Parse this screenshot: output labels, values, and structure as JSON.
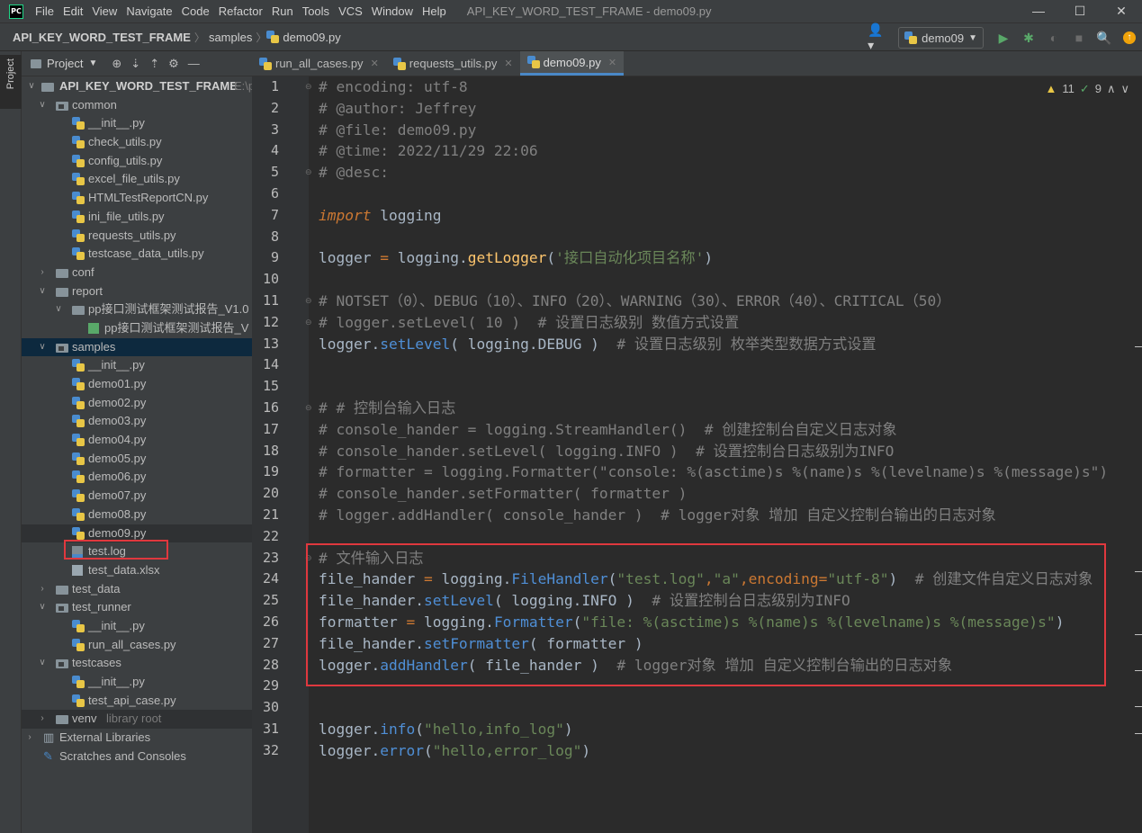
{
  "menubar": {
    "logo": "PC",
    "items": [
      "File",
      "Edit",
      "View",
      "Navigate",
      "Code",
      "Refactor",
      "Run",
      "Tools",
      "VCS",
      "Window",
      "Help"
    ],
    "window_title": "API_KEY_WORD_TEST_FRAME - demo09.py",
    "minimize": "—",
    "maximize": "☐",
    "close": "✕"
  },
  "navbar": {
    "project": "API_KEY_WORD_TEST_FRAME",
    "folder": "samples",
    "file": "demo09.py",
    "run_config": "demo09"
  },
  "project_panel": {
    "title": "Project",
    "root": "API_KEY_WORD_TEST_FRAME",
    "root_path": "E:\\p",
    "tree": [
      {
        "label": "common",
        "type": "folder",
        "depth": 1,
        "arrow": "open"
      },
      {
        "label": "__init__.py",
        "type": "py",
        "depth": 2
      },
      {
        "label": "check_utils.py",
        "type": "py",
        "depth": 2
      },
      {
        "label": "config_utils.py",
        "type": "py",
        "depth": 2
      },
      {
        "label": "excel_file_utils.py",
        "type": "py",
        "depth": 2
      },
      {
        "label": "HTMLTestReportCN.py",
        "type": "py",
        "depth": 2
      },
      {
        "label": "ini_file_utils.py",
        "type": "py",
        "depth": 2
      },
      {
        "label": "requests_utils.py",
        "type": "py",
        "depth": 2
      },
      {
        "label": "testcase_data_utils.py",
        "type": "py",
        "depth": 2
      },
      {
        "label": "conf",
        "type": "folder",
        "depth": 1,
        "arrow": "closed"
      },
      {
        "label": "report",
        "type": "folder",
        "depth": 1,
        "arrow": "open"
      },
      {
        "label": "pp接口测试框架测试报告_V1.0",
        "type": "folder",
        "depth": 2,
        "arrow": "open"
      },
      {
        "label": "pp接口测试框架测试报告_V",
        "type": "html",
        "depth": 3
      },
      {
        "label": "samples",
        "type": "folder",
        "depth": 1,
        "arrow": "open",
        "selected": true
      },
      {
        "label": "__init__.py",
        "type": "py",
        "depth": 2
      },
      {
        "label": "demo01.py",
        "type": "py",
        "depth": 2
      },
      {
        "label": "demo02.py",
        "type": "py",
        "depth": 2
      },
      {
        "label": "demo03.py",
        "type": "py",
        "depth": 2
      },
      {
        "label": "demo04.py",
        "type": "py",
        "depth": 2
      },
      {
        "label": "demo05.py",
        "type": "py",
        "depth": 2
      },
      {
        "label": "demo06.py",
        "type": "py",
        "depth": 2
      },
      {
        "label": "demo07.py",
        "type": "py",
        "depth": 2
      },
      {
        "label": "demo08.py",
        "type": "py",
        "depth": 2
      },
      {
        "label": "demo09.py",
        "type": "py",
        "depth": 2,
        "hl": true
      },
      {
        "label": "test.log",
        "type": "log",
        "depth": 2
      },
      {
        "label": "test_data.xlsx",
        "type": "xlsx",
        "depth": 2
      },
      {
        "label": "test_data",
        "type": "folder",
        "depth": 1,
        "arrow": "closed"
      },
      {
        "label": "test_runner",
        "type": "folder",
        "depth": 1,
        "arrow": "open"
      },
      {
        "label": "__init__.py",
        "type": "py",
        "depth": 2
      },
      {
        "label": "run_all_cases.py",
        "type": "py",
        "depth": 2
      },
      {
        "label": "testcases",
        "type": "folder",
        "depth": 1,
        "arrow": "open"
      },
      {
        "label": "__init__.py",
        "type": "py",
        "depth": 2
      },
      {
        "label": "test_api_case.py",
        "type": "py",
        "depth": 2
      },
      {
        "label": "venv",
        "type": "folder",
        "depth": 1,
        "arrow": "closed",
        "suffix": "library root",
        "hl": true
      },
      {
        "label": "External Libraries",
        "type": "lib",
        "depth": 0,
        "arrow": "closed"
      },
      {
        "label": "Scratches and Consoles",
        "type": "scratch",
        "depth": 0
      }
    ]
  },
  "tabs": [
    {
      "label": "run_all_cases.py",
      "active": false
    },
    {
      "label": "requests_utils.py",
      "active": false
    },
    {
      "label": "demo09.py",
      "active": true
    }
  ],
  "inspections": {
    "warnings": "11",
    "weak": "9"
  },
  "code_lines": [
    [
      [
        "c",
        "# encoding: utf-8"
      ]
    ],
    [
      [
        "c",
        "# @author: Jeffrey"
      ]
    ],
    [
      [
        "c",
        "# @file: demo09.py"
      ]
    ],
    [
      [
        "c",
        "# @time: 2022/11/29 22:06"
      ]
    ],
    [
      [
        "c",
        "# @desc:"
      ]
    ],
    [],
    [
      [
        "k",
        "import"
      ],
      [
        "p",
        " logging"
      ]
    ],
    [],
    [
      [
        "p",
        "logger "
      ],
      [
        "op",
        "="
      ],
      [
        "p",
        " logging."
      ],
      [
        "f",
        "getLogger"
      ],
      [
        "p",
        "("
      ],
      [
        "s",
        "'接口自动化项目名称'"
      ],
      [
        "p",
        ")"
      ]
    ],
    [],
    [
      [
        "c",
        "# NOTSET（0）、DEBUG（10）、INFO（20）、WARNING（30）、ERROR（40）、CRITICAL（50）"
      ]
    ],
    [
      [
        "c",
        "# logger.setLevel( 10 )  # 设置日志级别 数值方式设置"
      ]
    ],
    [
      [
        "p",
        "logger."
      ],
      [
        "m",
        "setLevel"
      ],
      [
        "p",
        "( logging.DEBUG )  "
      ],
      [
        "c",
        "# 设置日志级别 枚举类型数据方式设置"
      ]
    ],
    [],
    [],
    [
      [
        "c",
        "# # 控制台输入日志"
      ]
    ],
    [
      [
        "c",
        "# console_hander = logging.StreamHandler()  # 创建控制台自定义日志对象"
      ]
    ],
    [
      [
        "c",
        "# console_hander.setLevel( logging.INFO )  # 设置控制台日志级别为INFO"
      ]
    ],
    [
      [
        "c",
        "# formatter = logging.Formatter(\"console: %(asctime)s %(name)s %(levelname)s %(message)s\")"
      ]
    ],
    [
      [
        "c",
        "# console_hander.setFormatter( formatter )"
      ]
    ],
    [
      [
        "c",
        "# logger.addHandler( console_hander )  # logger对象 增加 自定义控制台输出的日志对象"
      ]
    ],
    [],
    [
      [
        "c",
        "# 文件输入日志"
      ]
    ],
    [
      [
        "p",
        "file_hander "
      ],
      [
        "op",
        "="
      ],
      [
        "p",
        " logging."
      ],
      [
        "m",
        "FileHandler"
      ],
      [
        "p",
        "("
      ],
      [
        "s",
        "\"test.log\""
      ],
      [
        "op",
        ","
      ],
      [
        "s",
        "\"a\""
      ],
      [
        "op",
        ","
      ],
      [
        "kw",
        "encoding"
      ],
      [
        "op",
        "="
      ],
      [
        "s",
        "\"utf-8\""
      ],
      [
        "p",
        ")  "
      ],
      [
        "c",
        "# 创建文件自定义日志对象"
      ]
    ],
    [
      [
        "p",
        "file_hander."
      ],
      [
        "m",
        "setLevel"
      ],
      [
        "p",
        "( logging.INFO )  "
      ],
      [
        "c",
        "# 设置控制台日志级别为INFO"
      ]
    ],
    [
      [
        "p",
        "formatter "
      ],
      [
        "op",
        "="
      ],
      [
        "p",
        " logging."
      ],
      [
        "m",
        "Formatter"
      ],
      [
        "p",
        "("
      ],
      [
        "s",
        "\"file: %(asctime)s %(name)s %(levelname)s %(message)s\""
      ],
      [
        "p",
        ")"
      ]
    ],
    [
      [
        "p",
        "file_hander."
      ],
      [
        "m",
        "setFormatter"
      ],
      [
        "p",
        "( formatter )"
      ]
    ],
    [
      [
        "p",
        "logger."
      ],
      [
        "m",
        "addHandler"
      ],
      [
        "p",
        "( file_hander )  "
      ],
      [
        "c",
        "# logger对象 增加 自定义控制台输出的日志对象"
      ]
    ],
    [],
    [],
    [
      [
        "p",
        "logger."
      ],
      [
        "m",
        "info"
      ],
      [
        "p",
        "("
      ],
      [
        "s",
        "\"hello,info_log\""
      ],
      [
        "p",
        ")"
      ]
    ],
    [
      [
        "p",
        "logger."
      ],
      [
        "m",
        "error"
      ],
      [
        "p",
        "("
      ],
      [
        "s",
        "\"hello,error_log\""
      ],
      [
        "p",
        ")"
      ]
    ]
  ],
  "colors": {
    "accent": "#4a88c7",
    "highlight_box": "#e0383e",
    "string": "#6a8759",
    "keyword": "#cc7832",
    "comment": "#808080"
  }
}
